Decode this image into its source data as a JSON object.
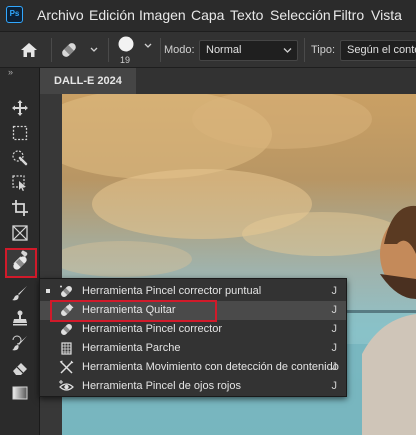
{
  "app": {
    "logo_text": "Ps"
  },
  "menu": [
    "Archivo",
    "Edición",
    "Imagen",
    "Capa",
    "Texto",
    "Selección",
    "Filtro",
    "Vista"
  ],
  "options_bar": {
    "brush_size": "19",
    "mode_label": "Modo:",
    "mode_value": "Normal",
    "type_label": "Tipo:",
    "type_value": "Según el conte"
  },
  "document": {
    "tab_title": "DALL-E 2024"
  },
  "toolbar": {
    "collapse_glyph": "»",
    "tools": [
      "move-tool",
      "marquee-tool",
      "quick-selection-tool",
      "crop-tool",
      "frame-tool",
      "eyedropper-tool",
      "healing-brush-tool",
      "brush-tool",
      "clone-stamp-tool",
      "history-brush-tool",
      "eraser-tool",
      "gradient-tool"
    ]
  },
  "flyout": {
    "items": [
      {
        "label": "Herramienta Pincel corrector puntual",
        "key": "J",
        "icon": "spot-healing-icon",
        "current": true
      },
      {
        "label": "Herramienta Quitar",
        "key": "J",
        "icon": "remove-tool-icon",
        "highlighted": true
      },
      {
        "label": "Herramienta Pincel corrector",
        "key": "J",
        "icon": "healing-brush-icon"
      },
      {
        "label": "Herramienta Parche",
        "key": "J",
        "icon": "patch-icon"
      },
      {
        "label": "Herramienta Movimiento con detección de contenido",
        "key": "J",
        "icon": "content-aware-move-icon"
      },
      {
        "label": "Herramienta Pincel de ojos rojos",
        "key": "J",
        "icon": "red-eye-icon"
      }
    ]
  },
  "colors": {
    "highlight_box": "#d11a2a",
    "ps_blue": "#31a8ff"
  }
}
